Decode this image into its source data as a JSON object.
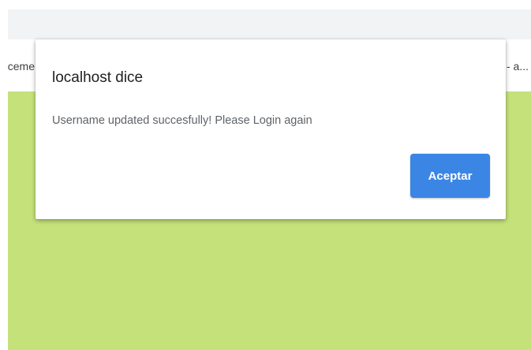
{
  "bookmarks": {
    "left_fragment": "ceme",
    "right_fragment": "- a..."
  },
  "dialog": {
    "title": "localhost dice",
    "message": "Username updated succesfully! Please Login again",
    "accept_label": "Aceptar"
  },
  "colors": {
    "page_background": "#c5e27a",
    "accept_button": "#3b86e5",
    "toolbar": "#f1f3f4"
  }
}
